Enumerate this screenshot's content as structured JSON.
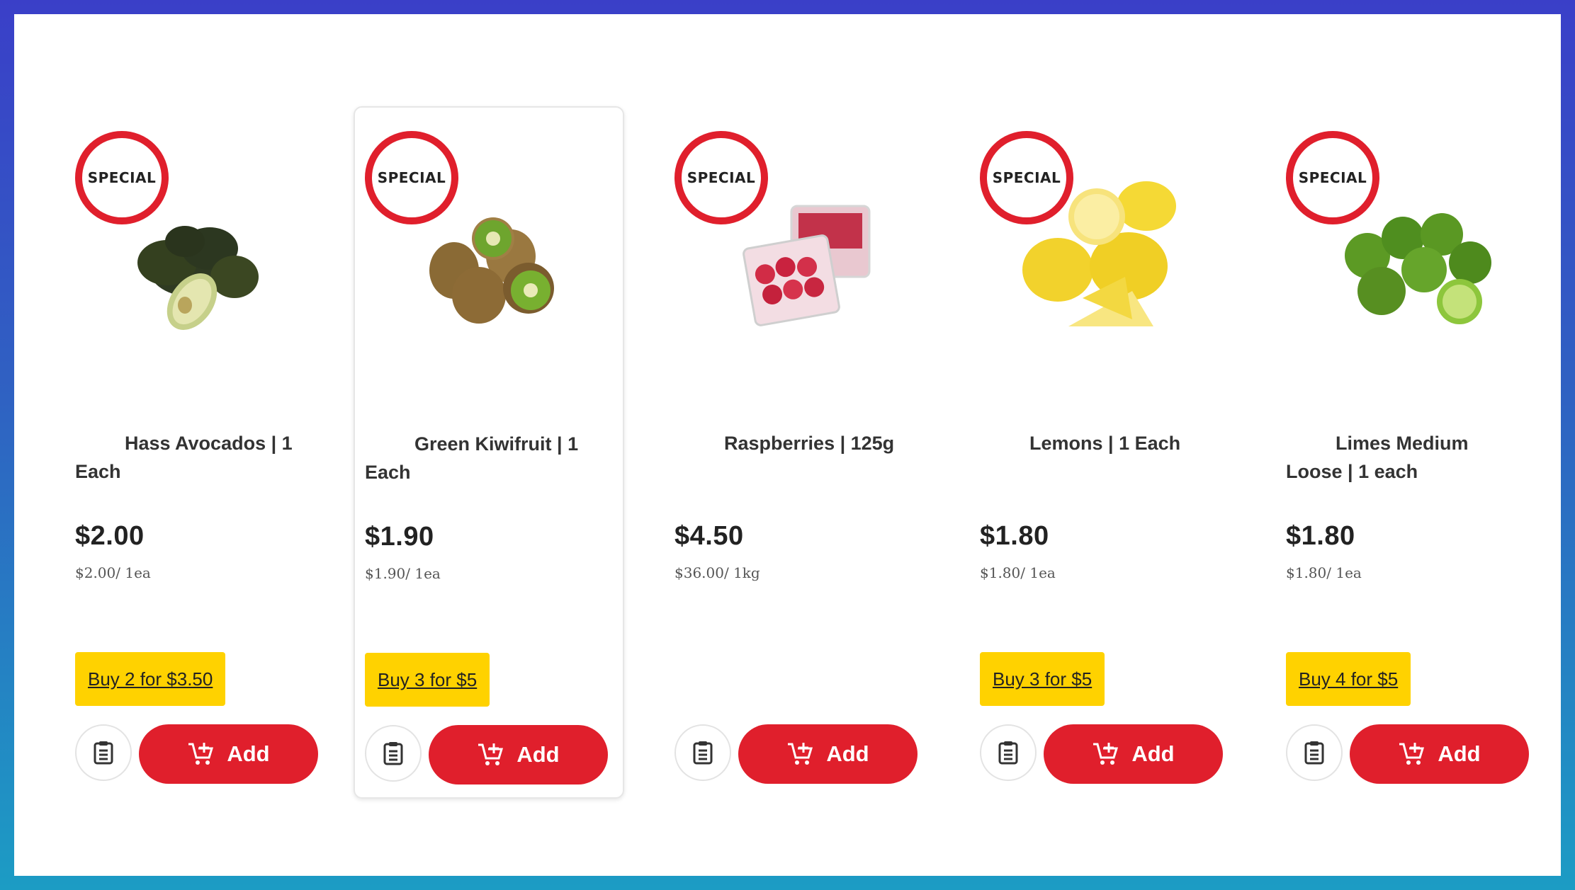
{
  "special_badge": "SPECIAL",
  "add_label": "Add",
  "colors": {
    "accent_red": "#e01f2c",
    "promo_yellow": "#ffd200"
  },
  "icons": {
    "list": "shopping-list-icon",
    "cart": "cart-add-icon"
  },
  "products": [
    {
      "title": "Hass Avocados | 1 Each",
      "price": "$2.00",
      "unit_price": "$2.00/ 1ea",
      "promo": "Buy 2 for $3.50"
    },
    {
      "title": "Green Kiwifruit | 1 Each",
      "price": "$1.90",
      "unit_price": "$1.90/ 1ea",
      "promo": "Buy 3 for $5"
    },
    {
      "title": "Raspberries | 125g",
      "price": "$4.50",
      "unit_price": "$36.00/ 1kg",
      "promo": ""
    },
    {
      "title": "Lemons | 1 Each",
      "price": "$1.80",
      "unit_price": "$1.80/ 1ea",
      "promo": "Buy 3 for $5"
    },
    {
      "title": "Limes Medium Loose | 1 each",
      "price": "$1.80",
      "unit_price": "$1.80/ 1ea",
      "promo": "Buy 4 for $5"
    }
  ]
}
